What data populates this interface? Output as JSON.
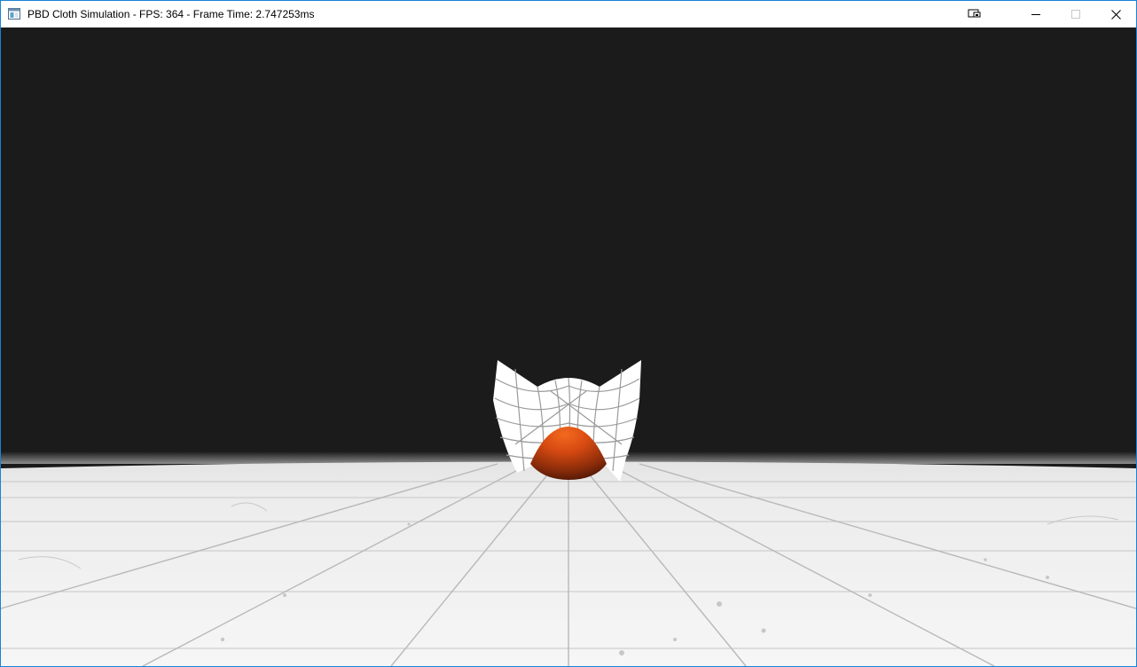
{
  "window": {
    "title": "PBD Cloth Simulation - FPS: 364 - Frame Time: 2.747253ms",
    "controls": [
      "restore-to-window-icon",
      "minimize-icon",
      "maximize-icon",
      "close-icon"
    ]
  },
  "scene": {
    "background_color": "#1b1b1b",
    "floor_color": "#eeeeee",
    "cloth_color": "#ffffff",
    "sphere_color": "#d84a12",
    "grid_line_color": "#8c8c8c"
  }
}
